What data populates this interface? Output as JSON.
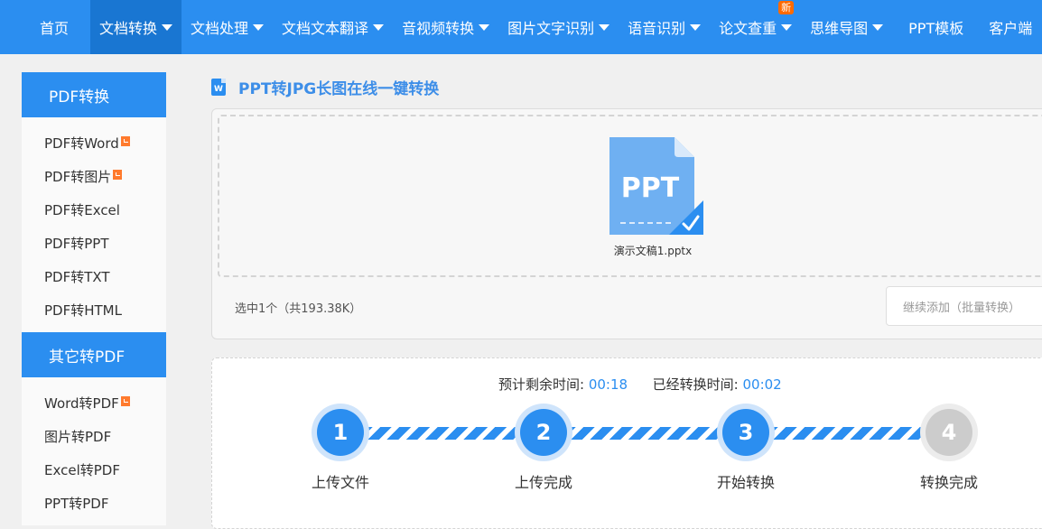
{
  "nav": {
    "items": [
      {
        "label": "首页",
        "dropdown": false,
        "active": false
      },
      {
        "label": "文档转换",
        "dropdown": true,
        "active": true
      },
      {
        "label": "文档处理",
        "dropdown": true,
        "active": false
      },
      {
        "label": "文档文本翻译",
        "dropdown": true,
        "active": false
      },
      {
        "label": "音视频转换",
        "dropdown": true,
        "active": false
      },
      {
        "label": "图片文字识别",
        "dropdown": true,
        "active": false
      },
      {
        "label": "语音识别",
        "dropdown": true,
        "active": false
      },
      {
        "label": "论文查重",
        "dropdown": true,
        "active": false,
        "badge": "新"
      },
      {
        "label": "思维导图",
        "dropdown": true,
        "active": false
      },
      {
        "label": "PPT模板",
        "dropdown": false,
        "active": false
      },
      {
        "label": "客户端",
        "dropdown": false,
        "active": false
      }
    ],
    "background_color": "#2b8ef0",
    "active_color": "#1976d2"
  },
  "sidebar": {
    "groups": [
      {
        "title": "PDF转换",
        "items": [
          {
            "label": "PDF转Word",
            "vip": true
          },
          {
            "label": "PDF转图片",
            "vip": true
          },
          {
            "label": "PDF转Excel",
            "vip": false
          },
          {
            "label": "PDF转PPT",
            "vip": false
          },
          {
            "label": "PDF转TXT",
            "vip": false
          },
          {
            "label": "PDF转HTML",
            "vip": false
          }
        ]
      },
      {
        "title": "其它转PDF",
        "items": [
          {
            "label": "Word转PDF",
            "vip": true
          },
          {
            "label": "图片转PDF",
            "vip": false
          },
          {
            "label": "Excel转PDF",
            "vip": false
          },
          {
            "label": "PPT转PDF",
            "vip": false
          }
        ]
      }
    ]
  },
  "main": {
    "icon_letter": "W",
    "title": "PPT转JPG长图在线一键转换"
  },
  "upload": {
    "file_type_label": "PPT",
    "file_name": "演示文稿1.pptx",
    "selection_info": "选中1个（共193.38K）",
    "add_more_label": "继续添加（批量转换）"
  },
  "progress": {
    "remaining_label": "预计剩余时间:",
    "remaining_value": "00:18",
    "elapsed_label": "已经转换时间:",
    "elapsed_value": "00:02",
    "steps": [
      {
        "number": "1",
        "label": "上传文件",
        "done": true
      },
      {
        "number": "2",
        "label": "上传完成",
        "done": true
      },
      {
        "number": "3",
        "label": "开始转换",
        "done": true
      },
      {
        "number": "4",
        "label": "转换完成",
        "done": false
      }
    ],
    "accent_color": "#2b8ef0"
  }
}
